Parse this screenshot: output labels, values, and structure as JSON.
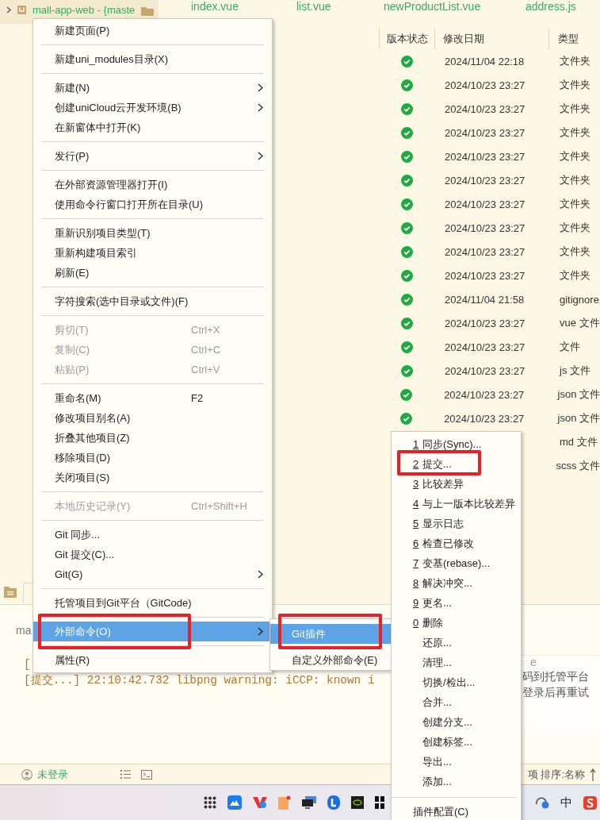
{
  "project_tree": {
    "name": "mall-app-web - {maste"
  },
  "editor_tabs": [
    {
      "label": "index.vue"
    },
    {
      "label": "list.vue"
    },
    {
      "label": "newProductList.vue"
    },
    {
      "label": "address.js"
    }
  ],
  "file_table": {
    "columns": [
      "版本状态",
      "修改日期",
      "类型"
    ],
    "rows": [
      {
        "committed": true,
        "date": "2024/11/04 22:18",
        "type": "文件夹"
      },
      {
        "committed": true,
        "date": "2024/10/23 23:27",
        "type": "文件夹"
      },
      {
        "committed": true,
        "date": "2024/10/23 23:27",
        "type": "文件夹"
      },
      {
        "committed": true,
        "date": "2024/10/23 23:27",
        "type": "文件夹"
      },
      {
        "committed": true,
        "date": "2024/10/23 23:27",
        "type": "文件夹"
      },
      {
        "committed": true,
        "date": "2024/10/23 23:27",
        "type": "文件夹"
      },
      {
        "committed": true,
        "date": "2024/10/23 23:27",
        "type": "文件夹"
      },
      {
        "committed": true,
        "date": "2024/10/23 23:27",
        "type": "文件夹"
      },
      {
        "committed": true,
        "date": "2024/10/23 23:27",
        "type": "文件夹"
      },
      {
        "committed": true,
        "date": "2024/10/23 23:27",
        "type": "文件夹"
      },
      {
        "committed": true,
        "date": "2024/11/04 21:58",
        "type": "gitignore"
      },
      {
        "committed": true,
        "date": "2024/10/23 23:27",
        "type": "vue 文件"
      },
      {
        "committed": true,
        "date": "2024/10/23 23:27",
        "type": "文件"
      },
      {
        "committed": true,
        "date": "2024/10/23 23:27",
        "type": "js 文件"
      },
      {
        "committed": true,
        "date": "2024/10/23 23:27",
        "type": "json 文件"
      },
      {
        "committed": true,
        "date": "2024/10/23 23:27",
        "type": "json 文件"
      },
      {
        "type": "md 文件"
      },
      {
        "type": "scss 文件"
      }
    ]
  },
  "context_menu": {
    "groups": [
      {
        "items": [
          {
            "label": "新建页面(P)",
            "submenu": false,
            "disabled": false,
            "selected": false,
            "highlighted": false
          }
        ]
      },
      {
        "items": [
          {
            "label": "新建uni_modules目录(X)",
            "submenu": false,
            "disabled": false,
            "selected": false,
            "highlighted": false
          }
        ]
      },
      {
        "items": [
          {
            "label": "新建(N)",
            "submenu": true,
            "disabled": false,
            "selected": false,
            "highlighted": false
          },
          {
            "label": "创建uniCloud云开发环境(B)",
            "submenu": true,
            "disabled": false,
            "selected": false,
            "highlighted": false
          },
          {
            "label": "在新窗体中打开(K)",
            "submenu": false,
            "disabled": false,
            "selected": false,
            "highlighted": false
          }
        ]
      },
      {
        "items": [
          {
            "label": "发行(P)",
            "submenu": true,
            "disabled": false,
            "selected": false,
            "highlighted": false
          }
        ]
      },
      {
        "items": [
          {
            "label": "在外部资源管理器打开(I)",
            "submenu": false,
            "disabled": false,
            "selected": false,
            "highlighted": false
          },
          {
            "label": "使用命令行窗口打开所在目录(U)",
            "submenu": false,
            "disabled": false,
            "selected": false,
            "highlighted": false
          }
        ]
      },
      {
        "items": [
          {
            "label": "重新识别项目类型(T)",
            "submenu": false,
            "disabled": false,
            "selected": false,
            "highlighted": false
          },
          {
            "label": "重新构建项目索引",
            "submenu": false,
            "disabled": false,
            "selected": false,
            "highlighted": false
          },
          {
            "label": "刷新(E)",
            "submenu": false,
            "disabled": false,
            "selected": false,
            "highlighted": false
          }
        ]
      },
      {
        "items": [
          {
            "label": "字符搜索(选中目录或文件)(F)",
            "submenu": false,
            "disabled": false,
            "selected": false,
            "highlighted": false
          }
        ]
      },
      {
        "items": [
          {
            "label": "剪切(T)",
            "shortcut": "Ctrl+X",
            "submenu": false,
            "disabled": true,
            "selected": false,
            "highlighted": false
          },
          {
            "label": "复制(C)",
            "shortcut": "Ctrl+C",
            "submenu": false,
            "disabled": true,
            "selected": false,
            "highlighted": false
          },
          {
            "label": "粘贴(P)",
            "shortcut": "Ctrl+V",
            "submenu": false,
            "disabled": true,
            "selected": false,
            "highlighted": false
          }
        ]
      },
      {
        "items": [
          {
            "label": "重命名(M)",
            "shortcut": "F2",
            "submenu": false,
            "disabled": false,
            "selected": false,
            "highlighted": false
          },
          {
            "label": "修改项目别名(A)",
            "submenu": false,
            "disabled": false,
            "selected": false,
            "highlighted": false
          },
          {
            "label": "折叠其他项目(Z)",
            "submenu": false,
            "disabled": false,
            "selected": false,
            "highlighted": false
          },
          {
            "label": "移除项目(D)",
            "submenu": false,
            "disabled": false,
            "selected": false,
            "highlighted": false
          },
          {
            "label": "关闭项目(S)",
            "submenu": false,
            "disabled": false,
            "selected": false,
            "highlighted": false
          }
        ]
      },
      {
        "items": [
          {
            "label": "本地历史记录(Y)",
            "shortcut": "Ctrl+Shift+H",
            "submenu": false,
            "disabled": true,
            "selected": false,
            "highlighted": false
          }
        ]
      },
      {
        "items": [
          {
            "label": "Git 同步...",
            "submenu": false,
            "disabled": false,
            "selected": false,
            "highlighted": false
          },
          {
            "label": "Git 提交(C)...",
            "submenu": false,
            "disabled": false,
            "selected": false,
            "highlighted": false
          },
          {
            "label": "Git(G)",
            "submenu": true,
            "disabled": false,
            "selected": false,
            "highlighted": false
          }
        ]
      },
      {
        "items": [
          {
            "label": "托管项目到Git平台（GitCode)",
            "submenu": false,
            "disabled": false,
            "selected": false,
            "highlighted": false
          }
        ]
      },
      {
        "items": [
          {
            "label": "外部命令(O)",
            "submenu": true,
            "disabled": false,
            "selected": true,
            "highlighted": true
          }
        ]
      },
      {
        "items": [
          {
            "label": "属性(R)",
            "submenu": false,
            "disabled": false,
            "selected": false,
            "highlighted": false
          }
        ]
      }
    ]
  },
  "external_submenu": {
    "items": [
      {
        "label": "Git插件",
        "selected": true,
        "highlighted": true
      },
      {
        "label": "自定义外部命令(E)",
        "selected": false,
        "highlighted": false
      }
    ]
  },
  "git_menu": {
    "items": [
      {
        "number": "1",
        "label": "同步(Sync)...",
        "highlighted": false
      },
      {
        "number": "2",
        "label": "提交...",
        "highlighted": true
      },
      {
        "number": "3",
        "label": "比较差异",
        "highlighted": false
      },
      {
        "number": "4",
        "label": "与上一版本比较差异",
        "highlighted": false
      },
      {
        "number": "5",
        "label": "显示日志",
        "highlighted": false
      },
      {
        "number": "6",
        "label": "检查已修改",
        "highlighted": false
      },
      {
        "number": "7",
        "label": "变基(rebase)...",
        "highlighted": false
      },
      {
        "number": "8",
        "label": "解决冲突...",
        "highlighted": false
      },
      {
        "number": "9",
        "label": "更名...",
        "highlighted": false
      },
      {
        "number": "0",
        "label": "删除",
        "highlighted": false
      },
      {
        "label": "还原...",
        "highlighted": false
      },
      {
        "label": "清理...",
        "highlighted": false
      },
      {
        "label": "切换/检出...",
        "highlighted": false
      },
      {
        "label": "合并...",
        "highlighted": false
      },
      {
        "label": "创建分支...",
        "highlighted": false
      },
      {
        "label": "创建标签...",
        "highlighted": false
      },
      {
        "label": "导出...",
        "highlighted": false
      },
      {
        "label": "添加...",
        "highlighted": false
      }
    ],
    "footer": {
      "label": "插件配置(C)"
    }
  },
  "output": {
    "tab_label": "ma",
    "lines": [
      "[",
      "[提交...] 22:10:42.732 libpng warning: iCCP: known i"
    ]
  },
  "notification": {
    "title": "e",
    "lines": [
      "码到托管平台",
      "登录后再重试"
    ]
  },
  "status_bar": {
    "user": "未登录",
    "summary": "项 排序:名称"
  },
  "taskbar": {
    "ime": "中"
  }
}
